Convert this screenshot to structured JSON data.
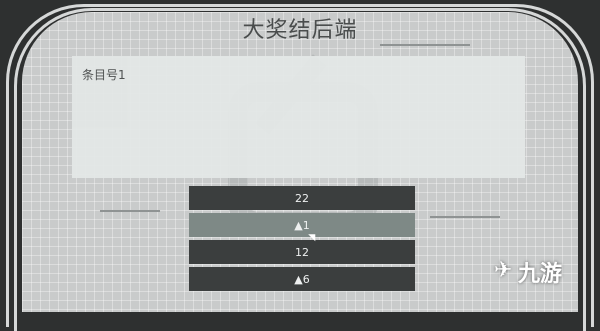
{
  "screen": {
    "title": "大奖结后端"
  },
  "panel": {
    "label": "条目号1"
  },
  "options": [
    {
      "label": "22",
      "selected": false
    },
    {
      "label": "▲1",
      "selected": true
    },
    {
      "label": "12",
      "selected": false
    },
    {
      "label": "▲6",
      "selected": false
    }
  ],
  "branding": {
    "text": "九游",
    "icon": "jiuyou-logo-icon"
  },
  "colors": {
    "frame_dark": "#2e3030",
    "grid_light": "#c9cbcb",
    "button_dark": "#3b3e3e",
    "button_selected": "#7e8986",
    "panel_bg": "#e3e7e6"
  }
}
